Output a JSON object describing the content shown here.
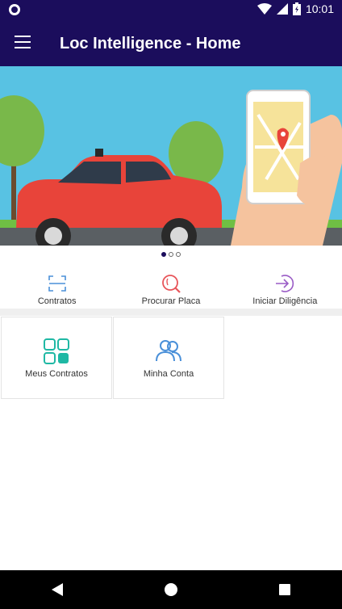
{
  "status_bar": {
    "time": "10:01"
  },
  "app_bar": {
    "title": "Loc Intelligence - Home"
  },
  "carousel": {
    "total": 3,
    "active": 1
  },
  "quick_actions": [
    {
      "label": "Contratos",
      "icon": "scan-icon"
    },
    {
      "label": "Procurar Placa",
      "icon": "search-plate-icon"
    },
    {
      "label": "Iniciar Diligência",
      "icon": "login-arrow-icon"
    }
  ],
  "tiles": [
    {
      "label": "Meus Contratos",
      "icon": "grid-icon"
    },
    {
      "label": "Minha Conta",
      "icon": "users-icon"
    }
  ],
  "colors": {
    "primary": "#1b0d5c",
    "accent_blue": "#4a90d9",
    "accent_red": "#e8555a",
    "accent_purple": "#9a5cc6",
    "accent_teal": "#1fb8a4"
  }
}
